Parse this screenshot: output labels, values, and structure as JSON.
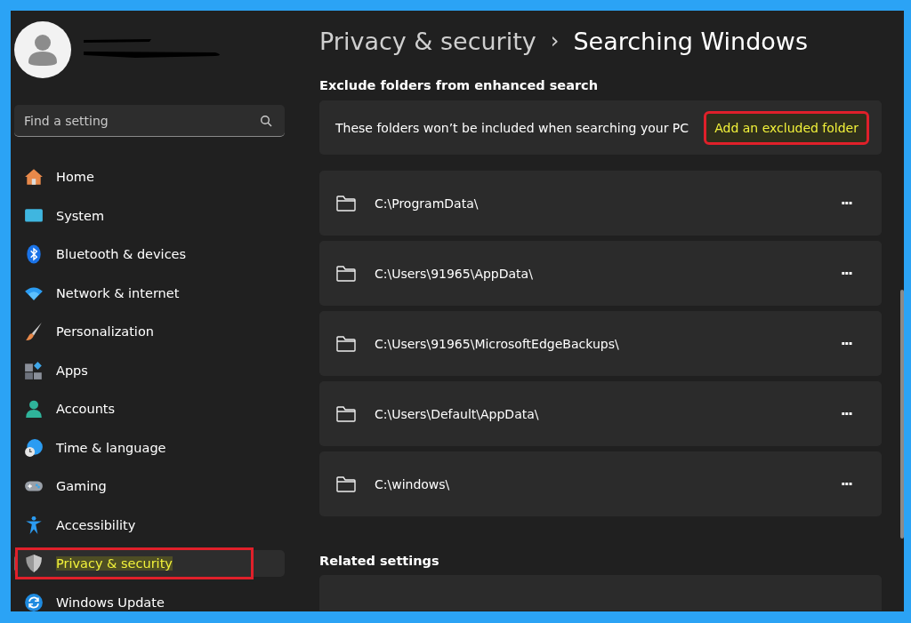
{
  "sidebar": {
    "search": {
      "placeholder": "Find a setting"
    },
    "items": [
      {
        "label": "Home",
        "kind": "home",
        "selected": false,
        "annotated": false
      },
      {
        "label": "System",
        "kind": "system",
        "selected": false,
        "annotated": false
      },
      {
        "label": "Bluetooth & devices",
        "kind": "bluetooth",
        "selected": false,
        "annotated": false
      },
      {
        "label": "Network & internet",
        "kind": "network",
        "selected": false,
        "annotated": false
      },
      {
        "label": "Personalization",
        "kind": "brush",
        "selected": false,
        "annotated": false
      },
      {
        "label": "Apps",
        "kind": "apps",
        "selected": false,
        "annotated": false
      },
      {
        "label": "Accounts",
        "kind": "accounts",
        "selected": false,
        "annotated": false
      },
      {
        "label": "Time & language",
        "kind": "time",
        "selected": false,
        "annotated": false
      },
      {
        "label": "Gaming",
        "kind": "gaming",
        "selected": false,
        "annotated": false
      },
      {
        "label": "Accessibility",
        "kind": "accessibility",
        "selected": false,
        "annotated": false
      },
      {
        "label": "Privacy & security",
        "kind": "shield",
        "selected": true,
        "annotated": true
      },
      {
        "label": "Windows Update",
        "kind": "update",
        "selected": false,
        "annotated": false
      }
    ]
  },
  "breadcrumb": {
    "parent": "Privacy & security",
    "separator": "›",
    "current": "Searching Windows"
  },
  "section": {
    "title": "Exclude folders from enhanced search",
    "description": "These folders won’t be included when searching your PC",
    "button": {
      "label": "Add an excluded folder",
      "annotated": true
    },
    "folders": [
      {
        "path": "C:\\ProgramData\\",
        "more": "···"
      },
      {
        "path": "C:\\Users\\91965\\AppData\\",
        "more": "···"
      },
      {
        "path": "C:\\Users\\91965\\MicrosoftEdgeBackups\\",
        "more": "···"
      },
      {
        "path": "C:\\Users\\Default\\AppData\\",
        "more": "···"
      },
      {
        "path": "C:\\windows\\",
        "more": "···"
      }
    ]
  },
  "related": {
    "title": "Related settings"
  }
}
